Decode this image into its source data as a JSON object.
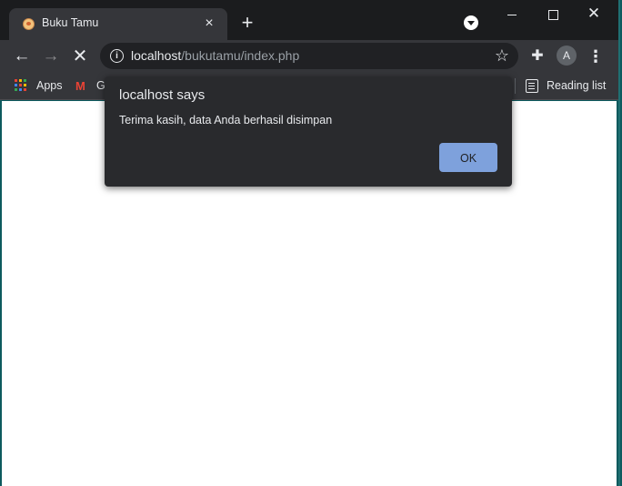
{
  "browser": {
    "tab": {
      "title": "Buku Tamu",
      "close_icon": "×"
    },
    "new_tab_icon": "+",
    "window_controls": {
      "close": "✕"
    },
    "toolbar": {
      "back_icon": "←",
      "forward_icon": "→",
      "stop_icon": "✕",
      "url_host": "localhost",
      "url_path": "/bukutamu/index.php",
      "info_icon": "i",
      "star_icon": "☆",
      "extensions_icon": "✚",
      "avatar_letter": "A",
      "menu_icon": "⋮"
    },
    "bookmarks": {
      "apps_label": "Apps",
      "gmail_icon": "M",
      "gmail_label": "G",
      "reading_list_label": "Reading list"
    }
  },
  "dialog": {
    "title": "localhost says",
    "message": "Terima kasih, data Anda berhasil disimpan",
    "ok_label": "OK"
  },
  "colors": {
    "accent_button": "#7ea1dc",
    "dialog_background": "#292a2d",
    "toolbar_background": "#35363a",
    "desktop_background": "#0d5a5e"
  }
}
